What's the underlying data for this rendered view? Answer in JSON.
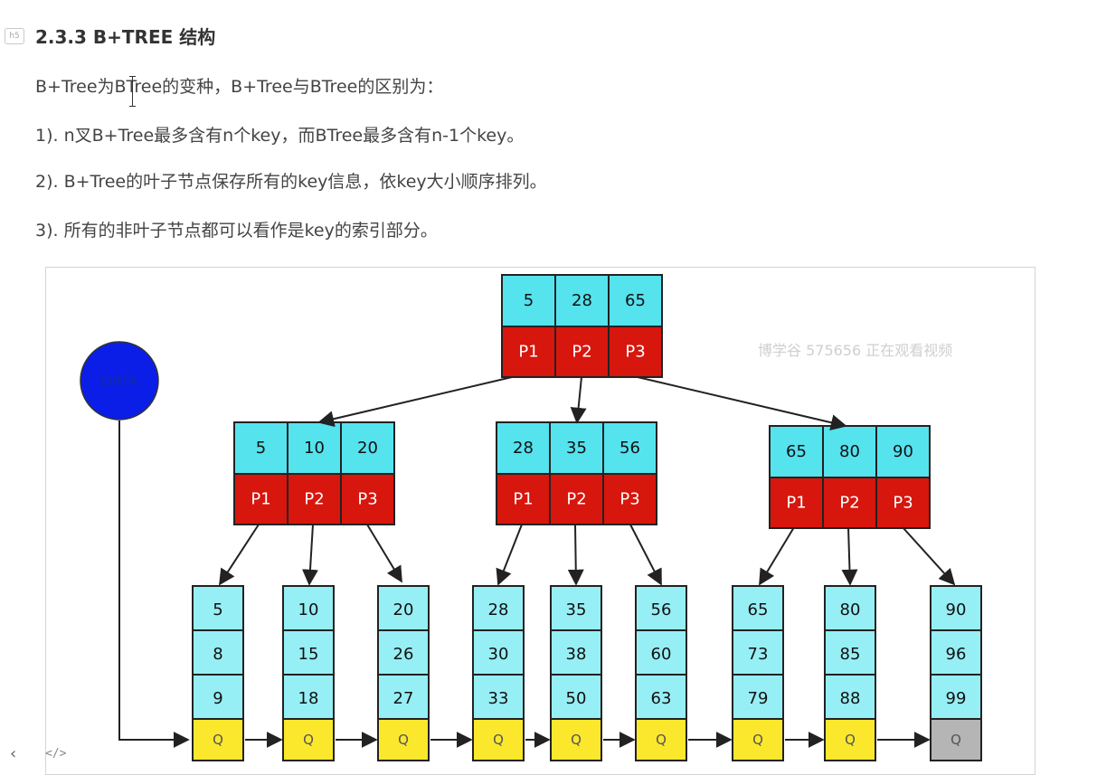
{
  "heading": {
    "tag": "h5",
    "text": "2.3.3 B+TREE 结构"
  },
  "paragraphs": [
    "B+Tree为BTree的变种，B+Tree与BTree的区别为：",
    "1). n叉B+Tree最多含有n个key，而BTree最多含有n-1个key。",
    "2). B+Tree的叶子节点保存所有的key信息，依key大小顺序排列。",
    "3). 所有的非叶子节点都可以看作是key的索引部分。"
  ],
  "diagram": {
    "data_label": "DATA",
    "root": {
      "keys": [
        "5",
        "28",
        "65"
      ],
      "pointers": [
        "P1",
        "P2",
        "P3"
      ]
    },
    "internal_nodes": [
      {
        "keys": [
          "5",
          "10",
          "20"
        ],
        "pointers": [
          "P1",
          "P2",
          "P3"
        ]
      },
      {
        "keys": [
          "28",
          "35",
          "56"
        ],
        "pointers": [
          "P1",
          "P2",
          "P3"
        ]
      },
      {
        "keys": [
          "65",
          "80",
          "90"
        ],
        "pointers": [
          "P1",
          "P2",
          "P3"
        ]
      }
    ],
    "leaves": [
      {
        "keys": [
          "5",
          "8",
          "9"
        ],
        "pointer": "Q"
      },
      {
        "keys": [
          "10",
          "15",
          "18"
        ],
        "pointer": "Q"
      },
      {
        "keys": [
          "20",
          "26",
          "27"
        ],
        "pointer": "Q"
      },
      {
        "keys": [
          "28",
          "30",
          "33"
        ],
        "pointer": "Q"
      },
      {
        "keys": [
          "35",
          "38",
          "50"
        ],
        "pointer": "Q"
      },
      {
        "keys": [
          "56",
          "60",
          "63"
        ],
        "pointer": "Q"
      },
      {
        "keys": [
          "65",
          "73",
          "79"
        ],
        "pointer": "Q"
      },
      {
        "keys": [
          "80",
          "85",
          "88"
        ],
        "pointer": "Q"
      },
      {
        "keys": [
          "90",
          "96",
          "99"
        ],
        "pointer": "Q"
      }
    ],
    "colors": {
      "key_fill": "#55e3ee",
      "leaf_key_fill": "#96eff5",
      "pointer_fill": "#d7160d",
      "leaf_pointer_fill": "#fbe82c",
      "last_pointer_fill": "#b5b5b5",
      "data_fill": "#0a1ee8",
      "stroke": "#222222"
    }
  },
  "watermark": "博学谷 575656 正在观看视频",
  "footer": {
    "prev_icon": "‹",
    "code_icon": "</>"
  }
}
